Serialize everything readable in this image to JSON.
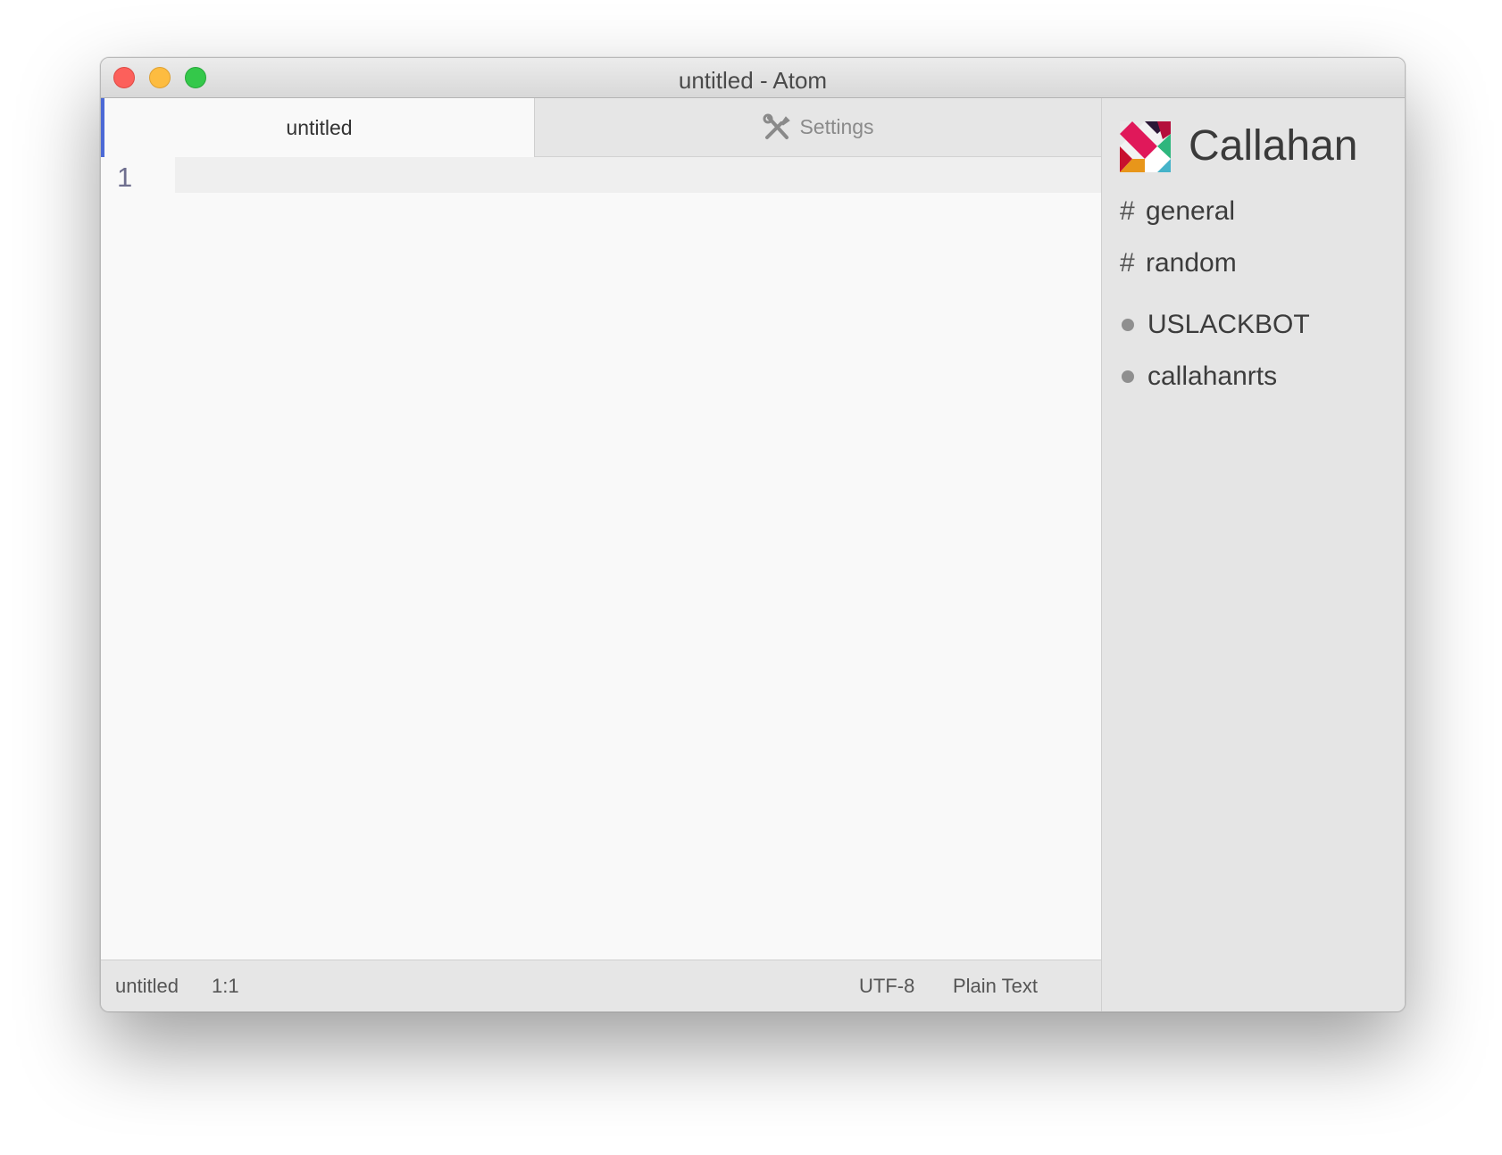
{
  "window": {
    "title": "untitled - Atom"
  },
  "tabs": [
    {
      "label": "untitled",
      "icon": ""
    },
    {
      "label": "Settings",
      "icon": "tools-icon"
    }
  ],
  "editor": {
    "line_numbers": [
      "1"
    ]
  },
  "statusbar": {
    "file_name": "untitled",
    "cursor_position": "1:1",
    "encoding": "UTF-8",
    "grammar": "Plain Text"
  },
  "sidebar": {
    "team_name": "Callahan",
    "channels": [
      {
        "prefix": "#",
        "name": "general"
      },
      {
        "prefix": "#",
        "name": "random"
      }
    ],
    "direct_messages": [
      {
        "name": "USLACKBOT"
      },
      {
        "name": "callahanrts"
      }
    ]
  },
  "colors": {
    "accent": "#4c6ad6",
    "close": "#fc605b",
    "minimize": "#fdbc40",
    "maximize": "#34c84a"
  }
}
